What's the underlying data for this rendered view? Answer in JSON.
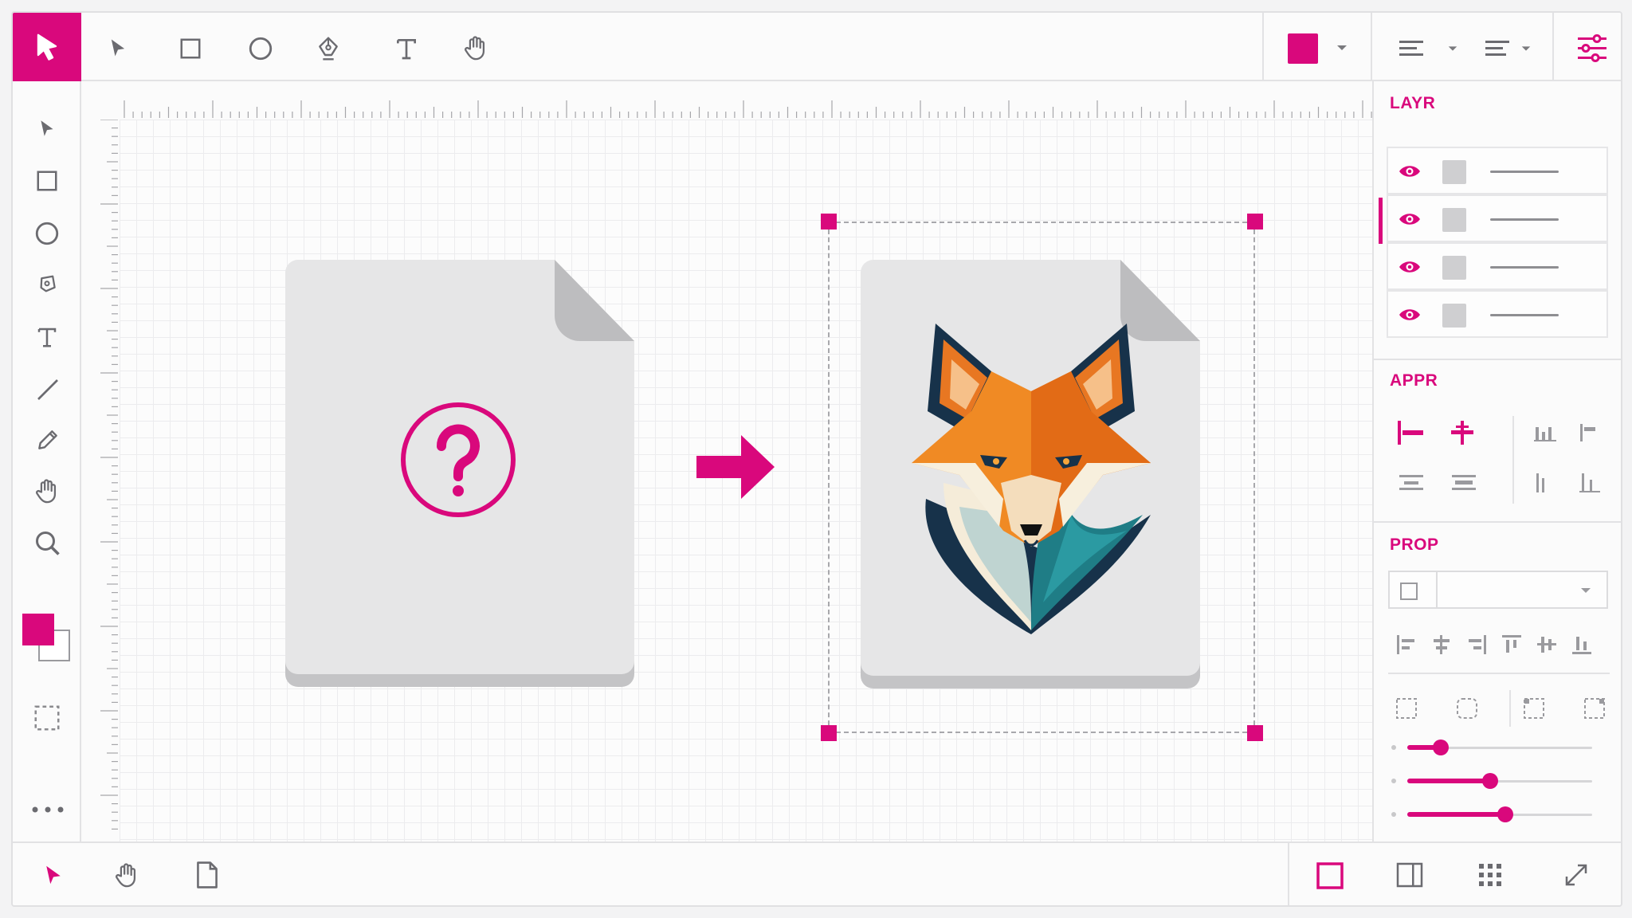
{
  "app": {
    "accent": "#d9087c"
  },
  "toolbar": {
    "tools": [
      "pointer-tool",
      "rectangle-tool",
      "ellipse-tool",
      "pen-tool",
      "text-tool",
      "hand-tool"
    ],
    "fill_color": "#d9087c"
  },
  "left_tools": [
    "select",
    "rectangle",
    "ellipse",
    "pen",
    "text",
    "line",
    "pencil",
    "hand",
    "zoom"
  ],
  "colors": {
    "foreground": "#d9087c",
    "background": "#ffffff"
  },
  "panels": {
    "layers": {
      "title": "LAYR",
      "rows": 4,
      "active_row": 2
    },
    "appearance": {
      "title": "APPR"
    },
    "properties": {
      "title": "PROP"
    }
  },
  "sliders": [
    0.18,
    0.45,
    0.53
  ],
  "canvas": {
    "source_file": {
      "icon": "question-mark-icon"
    },
    "result_file": {
      "icon": "fox-logo-image"
    },
    "arrow": "right-arrow-icon"
  }
}
